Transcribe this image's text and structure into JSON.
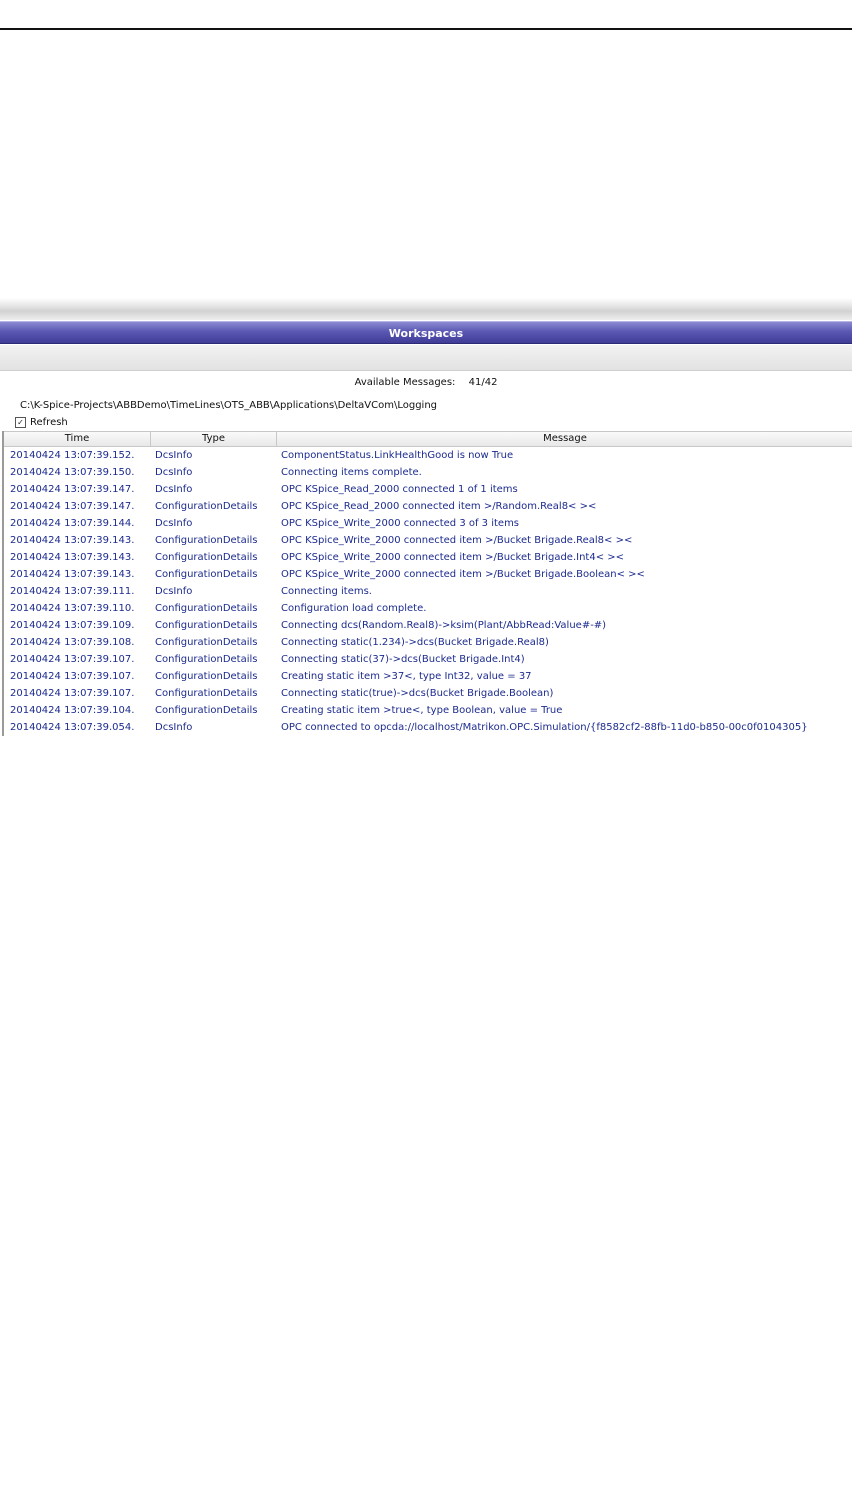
{
  "header": {
    "title": "Workspaces"
  },
  "panel": {
    "available_label": "Available Messages:",
    "available_count": "41/42",
    "path": "C:\\K-Spice-Projects\\ABBDemo\\TimeLines\\OTS_ABB\\Applications\\DeltaVCom\\Logging",
    "refresh_label": "Refresh",
    "refresh_checked": "✓"
  },
  "grid": {
    "columns": {
      "time": "Time",
      "type": "Type",
      "message": "Message"
    },
    "rows": [
      {
        "time": "20140424 13:07:39.152.",
        "type": "DcsInfo",
        "message": "ComponentStatus.LinkHealthGood is now True"
      },
      {
        "time": "20140424 13:07:39.150.",
        "type": "DcsInfo",
        "message": "Connecting items complete."
      },
      {
        "time": "20140424 13:07:39.147.",
        "type": "DcsInfo",
        "message": "OPC KSpice_Read_2000 connected 1 of 1 items"
      },
      {
        "time": "20140424 13:07:39.147.",
        "type": "ConfigurationDetails",
        "message": "OPC KSpice_Read_2000 connected item >/Random.Real8< ><"
      },
      {
        "time": "20140424 13:07:39.144.",
        "type": "DcsInfo",
        "message": "OPC KSpice_Write_2000 connected 3 of 3 items"
      },
      {
        "time": "20140424 13:07:39.143.",
        "type": "ConfigurationDetails",
        "message": "OPC KSpice_Write_2000 connected item >/Bucket Brigade.Real8< ><"
      },
      {
        "time": "20140424 13:07:39.143.",
        "type": "ConfigurationDetails",
        "message": "OPC KSpice_Write_2000 connected item >/Bucket Brigade.Int4< ><"
      },
      {
        "time": "20140424 13:07:39.143.",
        "type": "ConfigurationDetails",
        "message": "OPC KSpice_Write_2000 connected item >/Bucket Brigade.Boolean< ><"
      },
      {
        "time": "20140424 13:07:39.111.",
        "type": "DcsInfo",
        "message": "Connecting items."
      },
      {
        "time": "20140424 13:07:39.110.",
        "type": "ConfigurationDetails",
        "message": "Configuration load complete."
      },
      {
        "time": "20140424 13:07:39.109.",
        "type": "ConfigurationDetails",
        "message": "Connecting dcs(Random.Real8)->ksim(Plant/AbbRead:Value#-#)"
      },
      {
        "time": "20140424 13:07:39.108.",
        "type": "ConfigurationDetails",
        "message": "Connecting static(1.234)->dcs(Bucket Brigade.Real8)"
      },
      {
        "time": "20140424 13:07:39.107.",
        "type": "ConfigurationDetails",
        "message": "Connecting static(37)->dcs(Bucket Brigade.Int4)"
      },
      {
        "time": "20140424 13:07:39.107.",
        "type": "ConfigurationDetails",
        "message": "Creating static item >37<, type Int32, value = 37"
      },
      {
        "time": "20140424 13:07:39.107.",
        "type": "ConfigurationDetails",
        "message": "Connecting static(true)->dcs(Bucket Brigade.Boolean)"
      },
      {
        "time": "20140424 13:07:39.104.",
        "type": "ConfigurationDetails",
        "message": "Creating static item >true<, type Boolean, value = True"
      },
      {
        "time": "20140424 13:07:39.054.",
        "type": "DcsInfo",
        "message": "OPC connected to opcda://localhost/Matrikon.OPC.Simulation/{f8582cf2-88fb-11d0-b850-00c0f0104305}"
      }
    ]
  }
}
